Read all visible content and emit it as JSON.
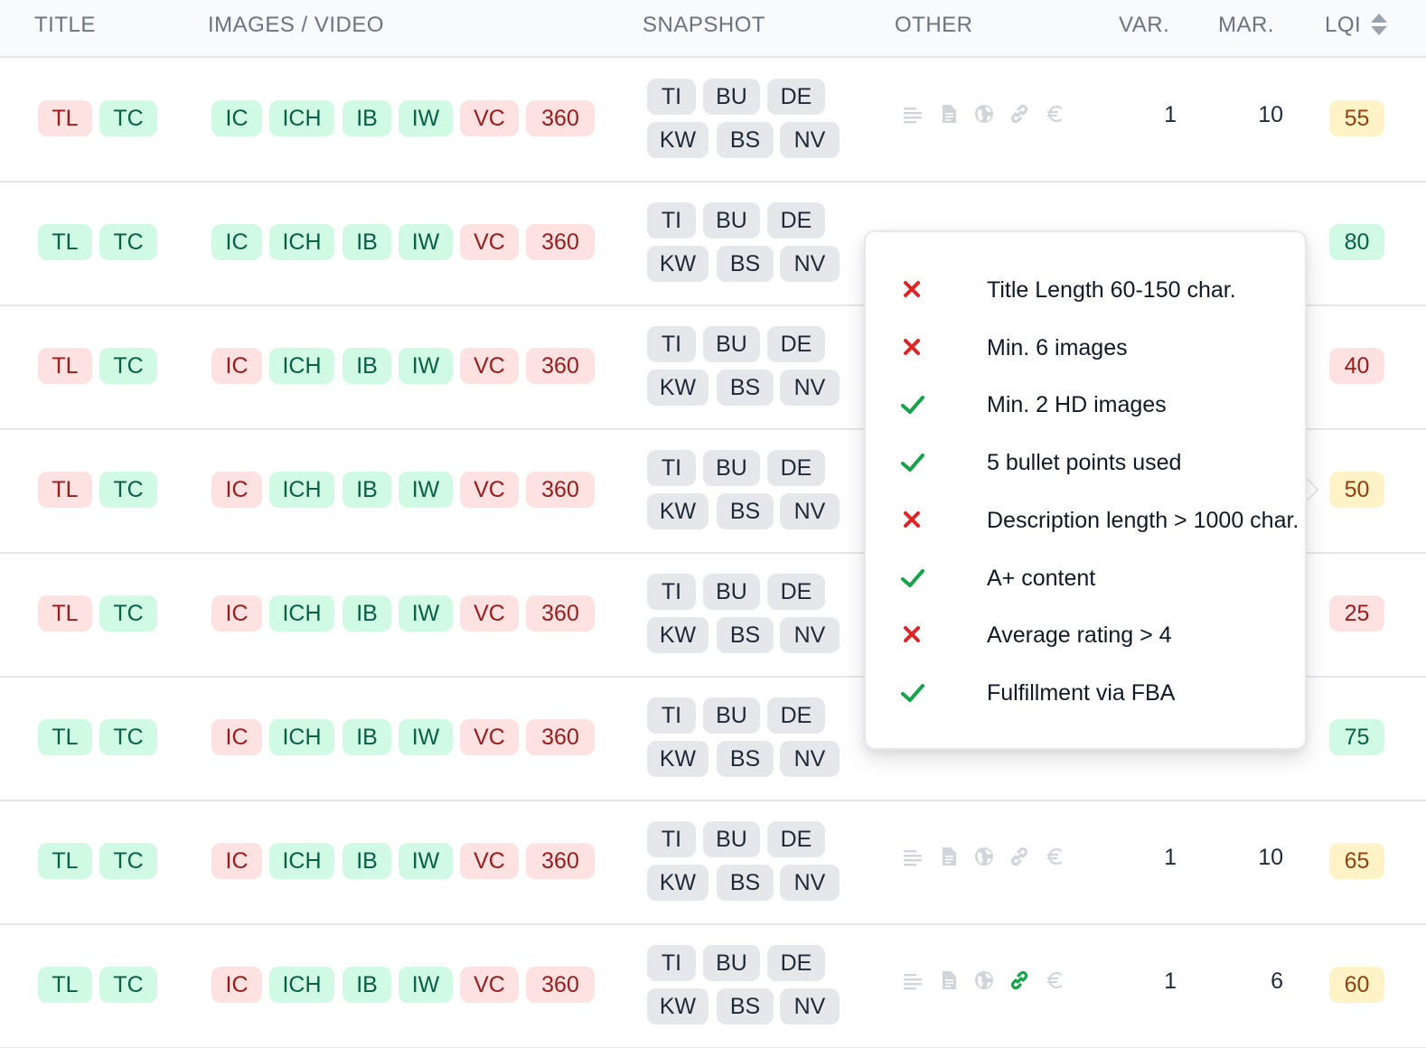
{
  "header": {
    "title": "TITLE",
    "images_video": "IMAGES / VIDEO",
    "snapshot": "SNAPSHOT",
    "other": "OTHER",
    "var": "VAR.",
    "mar": "MAR.",
    "lqi": "LQI"
  },
  "colors": {
    "green_bg": "#d1fae5",
    "green_text": "#065f46",
    "red_bg": "#fee2e2",
    "red_text": "#991b1b",
    "yellow_bg": "#fef3c7",
    "yellow_text": "#92400e",
    "gray_bg": "#e5e7eb",
    "check_green": "#16a34a",
    "cross_red": "#dc2626"
  },
  "rows": [
    {
      "title": [
        {
          "label": "TL",
          "status": "red"
        },
        {
          "label": "TC",
          "status": "green"
        }
      ],
      "images": [
        {
          "label": "IC",
          "status": "green"
        },
        {
          "label": "ICH",
          "status": "green"
        },
        {
          "label": "IB",
          "status": "green"
        },
        {
          "label": "IW",
          "status": "green"
        },
        {
          "label": "VC",
          "status": "red"
        },
        {
          "label": "360",
          "status": "red"
        }
      ],
      "snapshot": [
        "TI",
        "BU",
        "DE",
        "KW",
        "BS",
        "NV"
      ],
      "other_visible": true,
      "link_active": false,
      "var": "1",
      "mar": "10",
      "lqi": {
        "value": "55",
        "status": "yellow"
      }
    },
    {
      "title": [
        {
          "label": "TL",
          "status": "green"
        },
        {
          "label": "TC",
          "status": "green"
        }
      ],
      "images": [
        {
          "label": "IC",
          "status": "green"
        },
        {
          "label": "ICH",
          "status": "green"
        },
        {
          "label": "IB",
          "status": "green"
        },
        {
          "label": "IW",
          "status": "green"
        },
        {
          "label": "VC",
          "status": "red"
        },
        {
          "label": "360",
          "status": "red"
        }
      ],
      "snapshot": [
        "TI",
        "BU",
        "DE",
        "KW",
        "BS",
        "NV"
      ],
      "other_visible": false,
      "link_active": false,
      "var": "",
      "mar": "",
      "lqi": {
        "value": "80",
        "status": "green"
      }
    },
    {
      "title": [
        {
          "label": "TL",
          "status": "red"
        },
        {
          "label": "TC",
          "status": "green"
        }
      ],
      "images": [
        {
          "label": "IC",
          "status": "red"
        },
        {
          "label": "ICH",
          "status": "green"
        },
        {
          "label": "IB",
          "status": "green"
        },
        {
          "label": "IW",
          "status": "green"
        },
        {
          "label": "VC",
          "status": "red"
        },
        {
          "label": "360",
          "status": "red"
        }
      ],
      "snapshot": [
        "TI",
        "BU",
        "DE",
        "KW",
        "BS",
        "NV"
      ],
      "other_visible": false,
      "link_active": false,
      "var": "",
      "mar": "",
      "lqi": {
        "value": "40",
        "status": "red"
      }
    },
    {
      "title": [
        {
          "label": "TL",
          "status": "red"
        },
        {
          "label": "TC",
          "status": "green"
        }
      ],
      "images": [
        {
          "label": "IC",
          "status": "red"
        },
        {
          "label": "ICH",
          "status": "green"
        },
        {
          "label": "IB",
          "status": "green"
        },
        {
          "label": "IW",
          "status": "green"
        },
        {
          "label": "VC",
          "status": "red"
        },
        {
          "label": "360",
          "status": "red"
        }
      ],
      "snapshot": [
        "TI",
        "BU",
        "DE",
        "KW",
        "BS",
        "NV"
      ],
      "other_visible": false,
      "link_active": false,
      "var": "",
      "mar": "",
      "lqi": {
        "value": "50",
        "status": "yellow"
      }
    },
    {
      "title": [
        {
          "label": "TL",
          "status": "red"
        },
        {
          "label": "TC",
          "status": "green"
        }
      ],
      "images": [
        {
          "label": "IC",
          "status": "red"
        },
        {
          "label": "ICH",
          "status": "green"
        },
        {
          "label": "IB",
          "status": "green"
        },
        {
          "label": "IW",
          "status": "green"
        },
        {
          "label": "VC",
          "status": "red"
        },
        {
          "label": "360",
          "status": "red"
        }
      ],
      "snapshot": [
        "TI",
        "BU",
        "DE",
        "KW",
        "BS",
        "NV"
      ],
      "other_visible": false,
      "link_active": false,
      "var": "",
      "mar": "",
      "lqi": {
        "value": "25",
        "status": "red"
      }
    },
    {
      "title": [
        {
          "label": "TL",
          "status": "green"
        },
        {
          "label": "TC",
          "status": "green"
        }
      ],
      "images": [
        {
          "label": "IC",
          "status": "red"
        },
        {
          "label": "ICH",
          "status": "green"
        },
        {
          "label": "IB",
          "status": "green"
        },
        {
          "label": "IW",
          "status": "green"
        },
        {
          "label": "VC",
          "status": "red"
        },
        {
          "label": "360",
          "status": "red"
        }
      ],
      "snapshot": [
        "TI",
        "BU",
        "DE",
        "KW",
        "BS",
        "NV"
      ],
      "other_visible": false,
      "link_active": false,
      "var": "",
      "mar": "",
      "lqi": {
        "value": "75",
        "status": "green"
      }
    },
    {
      "title": [
        {
          "label": "TL",
          "status": "green"
        },
        {
          "label": "TC",
          "status": "green"
        }
      ],
      "images": [
        {
          "label": "IC",
          "status": "red"
        },
        {
          "label": "ICH",
          "status": "green"
        },
        {
          "label": "IB",
          "status": "green"
        },
        {
          "label": "IW",
          "status": "green"
        },
        {
          "label": "VC",
          "status": "red"
        },
        {
          "label": "360",
          "status": "red"
        }
      ],
      "snapshot": [
        "TI",
        "BU",
        "DE",
        "KW",
        "BS",
        "NV"
      ],
      "other_visible": true,
      "link_active": false,
      "var": "1",
      "mar": "10",
      "lqi": {
        "value": "65",
        "status": "yellow"
      }
    },
    {
      "title": [
        {
          "label": "TL",
          "status": "green"
        },
        {
          "label": "TC",
          "status": "green"
        }
      ],
      "images": [
        {
          "label": "IC",
          "status": "red"
        },
        {
          "label": "ICH",
          "status": "green"
        },
        {
          "label": "IB",
          "status": "green"
        },
        {
          "label": "IW",
          "status": "green"
        },
        {
          "label": "VC",
          "status": "red"
        },
        {
          "label": "360",
          "status": "red"
        }
      ],
      "snapshot": [
        "TI",
        "BU",
        "DE",
        "KW",
        "BS",
        "NV"
      ],
      "other_visible": true,
      "link_active": true,
      "var": "1",
      "mar": "6",
      "lqi": {
        "value": "60",
        "status": "yellow"
      }
    }
  ],
  "other_icons": [
    "text-lines-icon",
    "document-icon",
    "globe-icon",
    "link-icon",
    "euro-icon"
  ],
  "popover": {
    "items": [
      {
        "label": "Title Length 60-150 char.",
        "passed": false
      },
      {
        "label": "Min. 6 images",
        "passed": false
      },
      {
        "label": "Min. 2 HD images",
        "passed": true
      },
      {
        "label": "5 bullet points used",
        "passed": true
      },
      {
        "label": "Description length > 1000 char.",
        "passed": false
      },
      {
        "label": "A+ content",
        "passed": true
      },
      {
        "label": "Average rating > 4",
        "passed": false
      },
      {
        "label": "Fulfillment via FBA",
        "passed": true
      }
    ]
  }
}
